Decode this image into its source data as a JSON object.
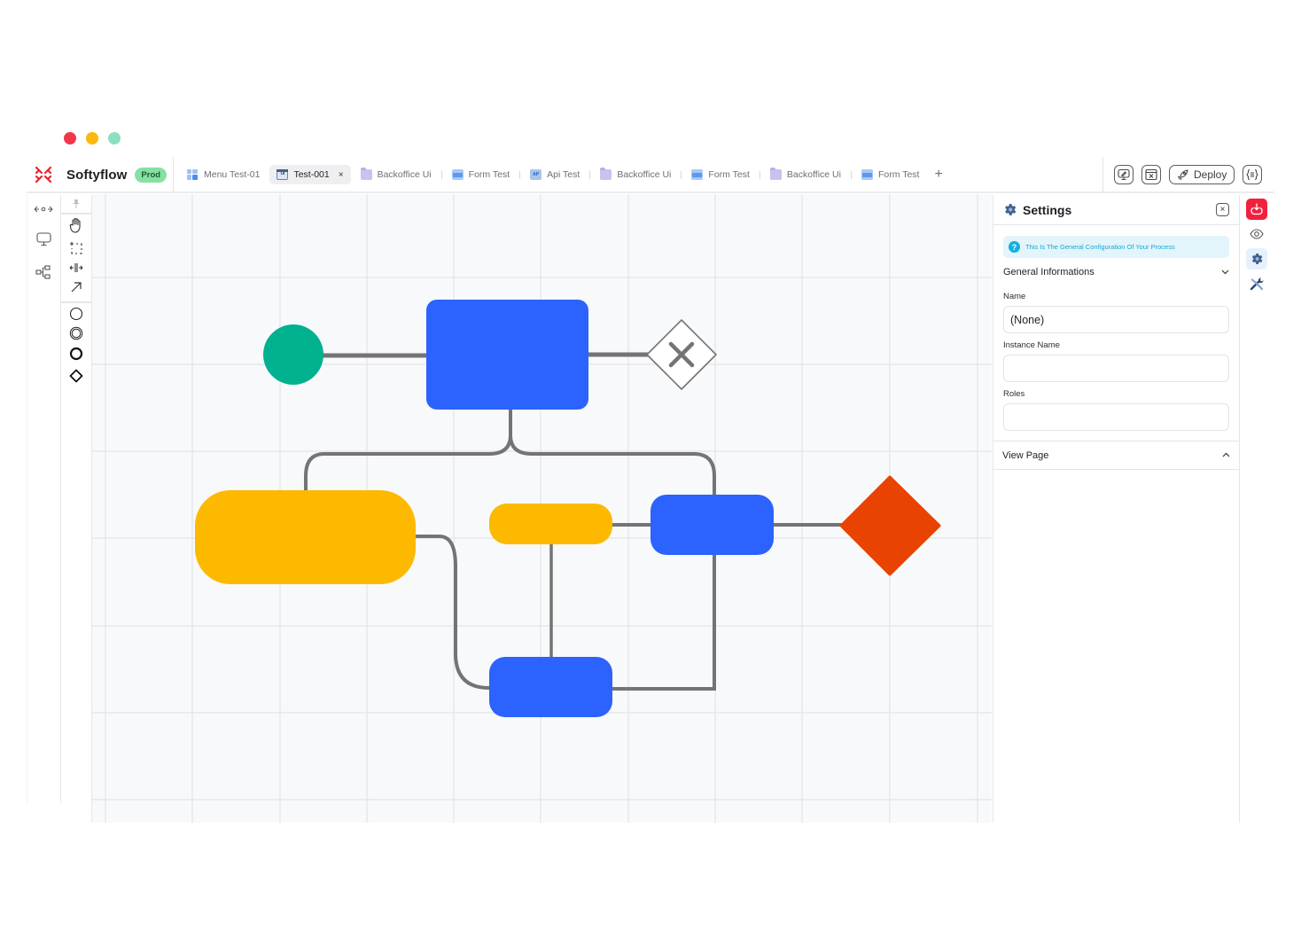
{
  "window": {
    "controls": [
      "close",
      "minimize",
      "maximize"
    ]
  },
  "brand": {
    "name": "Softyflow",
    "env_badge": "Prod",
    "logo_icon": "softyflow-x-logo",
    "accent": "#e8242f"
  },
  "tabs": [
    {
      "label": "Menu Test-01",
      "icon": "menu-grid-icon",
      "active": false
    },
    {
      "label": "Test-001",
      "icon": "ui-window-icon",
      "active": true,
      "closable": true,
      "close_label": "×"
    },
    {
      "label": "Backoffice Ui",
      "icon": "folder-icon",
      "active": false
    },
    {
      "label": "Form Test",
      "icon": "form-icon",
      "active": false
    },
    {
      "label": "Api Test",
      "icon": "api-cloud-icon",
      "active": false,
      "icon_text": "AP"
    },
    {
      "label": "Backoffice Ui",
      "icon": "folder-icon",
      "active": false
    },
    {
      "label": "Form Test",
      "icon": "form-icon",
      "active": false
    },
    {
      "label": "Backoffice Ui",
      "icon": "folder-icon",
      "active": false
    },
    {
      "label": "Form Test",
      "icon": "form-icon",
      "active": false
    }
  ],
  "add_tab_label": "+",
  "ui_icon_text": "UI",
  "actions": {
    "preview_icon": "monitor-edit-icon",
    "code_icon": "browser-code-icon",
    "deploy_label": "Deploy",
    "deploy_icon": "rocket-icon",
    "json_icon": "braces-icon"
  },
  "leftnav": [
    {
      "icon": "expand-arrows-icon"
    },
    {
      "icon": "monitor-icon"
    },
    {
      "icon": "diagram-tree-icon"
    }
  ],
  "toolbox": {
    "pin_icon": "pin-icon",
    "tools": [
      {
        "icon": "hand-tool-icon"
      },
      {
        "icon": "lasso-select-icon"
      },
      {
        "icon": "space-tool-icon"
      },
      {
        "icon": "connect-arrow-icon"
      }
    ],
    "shapes": [
      {
        "icon": "start-event-circle-icon"
      },
      {
        "icon": "intermediate-event-circle-icon"
      },
      {
        "icon": "end-event-circle-icon"
      },
      {
        "icon": "gateway-diamond-icon"
      }
    ]
  },
  "diagram": {
    "colors": {
      "start": "#00b190",
      "task": "#2c62fe",
      "subprocess": "#fdb900",
      "end": "#e84300",
      "connector": "#747474",
      "gateway_border": "#747474"
    },
    "nodes": [
      {
        "id": "start",
        "type": "start-event"
      },
      {
        "id": "task-main",
        "type": "task"
      },
      {
        "id": "gateway-exclusive",
        "type": "exclusive-gateway",
        "symbol": "×"
      },
      {
        "id": "subprocess-large",
        "type": "subprocess"
      },
      {
        "id": "subprocess-small",
        "type": "subprocess"
      },
      {
        "id": "task-right",
        "type": "task"
      },
      {
        "id": "end-diamond",
        "type": "end-gateway"
      },
      {
        "id": "task-bottom",
        "type": "task"
      }
    ]
  },
  "settings": {
    "title": "Settings",
    "close_label": "×",
    "info_text": "This Is The General Configuration Of Your Process",
    "info_icon_text": "?",
    "general_section": "General Informations",
    "general_chevron": "⌄",
    "fields": [
      {
        "label": "Name",
        "value": "(None)",
        "placeholder": ""
      },
      {
        "label": "Instance Name",
        "value": "",
        "placeholder": ""
      },
      {
        "label": "Roles",
        "value": "",
        "placeholder": ""
      }
    ],
    "view_page": "View Page",
    "view_page_chevron": "^"
  },
  "rightbar": [
    {
      "icon": "cloud-download-icon",
      "active": "red"
    },
    {
      "icon": "eye-icon"
    },
    {
      "icon": "gear-icon",
      "active": "blue"
    },
    {
      "icon": "tools-icon"
    }
  ]
}
